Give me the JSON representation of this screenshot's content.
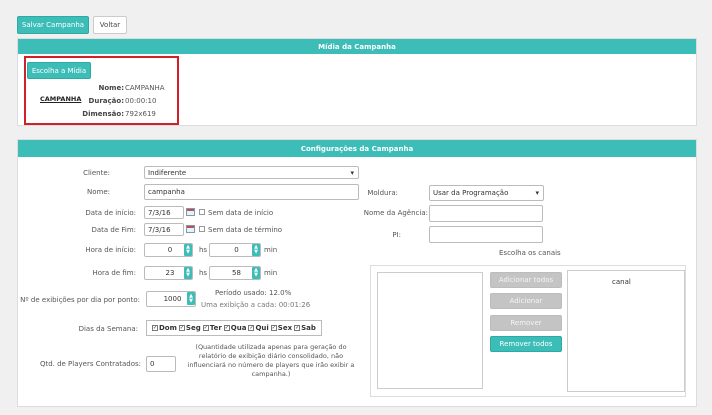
{
  "toolbar": {
    "save_label": "Salvar Campanha",
    "back_label": "Voltar"
  },
  "media": {
    "header": "Mídia da Campanha",
    "choose_label": "Escolha a Mídia",
    "thumb_text": "CAMPANHA",
    "name_label": "Nome:",
    "name_value": "CAMPANHA",
    "duration_label": "Duração:",
    "duration_value": "00:00:10",
    "dimension_label": "Dimensão:",
    "dimension_value": "792x619"
  },
  "config": {
    "header": "Configurações da Campanha",
    "client_label": "Cliente:",
    "client_value": "Indiferente",
    "name_label": "Nome:",
    "name_value": "campanha",
    "start_date_label": "Data de início:",
    "start_date_value": "7/3/16",
    "no_start_label": "Sem data de início",
    "end_date_label": "Data de Fim:",
    "end_date_value": "7/3/16",
    "no_end_label": "Sem data de término",
    "start_hour_label": "Hora de início:",
    "start_h": "0",
    "start_m": "0",
    "end_hour_label": "Hora de fim:",
    "end_h": "23",
    "end_m": "58",
    "hs": "hs",
    "min": "min",
    "exhibitions_label": "Nº de exibições por dia por ponto:",
    "exhibitions_value": "1000",
    "period_used": "Período usado: 12.0%",
    "one_exhibition": "Uma exibição a cada: 00:01:26",
    "days_label": "Dias da Semana:",
    "days": [
      "Dom",
      "Seg",
      "Ter",
      "Qua",
      "Qui",
      "Sex",
      "Sab"
    ],
    "players_label": "Qtd. de Players Contratados:",
    "players_value": "0",
    "players_note": "(Quantidade utilizada apenas para geração do relatório de exibição diário consolidado, não influenciará no número de players que irão exibir a campanha.)",
    "frame_label": "Moldura:",
    "frame_value": "Usar da Programação",
    "agency_label": "Nome da Agência:",
    "agency_value": "",
    "pi_label": "PI:",
    "pi_value": "",
    "channels_title": "Escolha os canais",
    "add_all": "Adicionar todos",
    "add": "Adicionar",
    "remove": "Remover",
    "remove_all": "Remover todos",
    "channel_item": "canal"
  }
}
